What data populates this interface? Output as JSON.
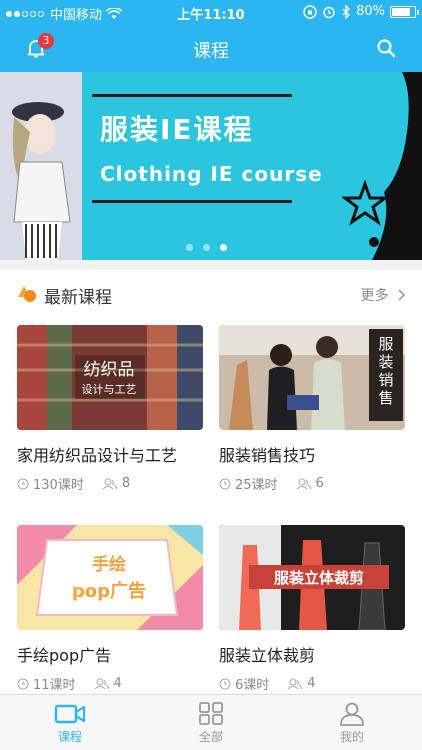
{
  "status_bar": {
    "carrier": "中国移动",
    "time": "上午11:10",
    "battery": "80%",
    "battery_level": 0.8
  },
  "header": {
    "title": "课程",
    "notification_count": "3"
  },
  "banner": {
    "title_cn": "服装IE课程",
    "title_en": "Clothing IE course",
    "active_page": 3,
    "pages": 3
  },
  "section": {
    "title": "最新课程",
    "more": "更多"
  },
  "courses": [
    {
      "title": "家用纺织品设计与工艺",
      "lessons": "130课时",
      "students": "8",
      "thumb_text": "纺织品\n设计与工艺",
      "thumb_color": "#8a3a3a"
    },
    {
      "title": "服装销售技巧",
      "lessons": "25课时",
      "students": "6",
      "thumb_text": "服装销售技巧",
      "thumb_color": "#c9b9a6"
    },
    {
      "title": "手绘pop广告",
      "lessons": "11课时",
      "students": "4",
      "thumb_text": "手绘pop广告",
      "thumb_color": "#f7e4a3"
    },
    {
      "title": "服装立体裁剪",
      "lessons": "6课时",
      "students": "4",
      "thumb_text": "服装立体裁剪",
      "thumb_color": "#2a2a2a"
    }
  ],
  "tabs": [
    {
      "label": "课程",
      "icon": "video-icon",
      "active": true
    },
    {
      "label": "全部",
      "icon": "grid-icon",
      "active": false
    },
    {
      "label": "我的",
      "icon": "user-icon",
      "active": false
    }
  ],
  "colors": {
    "primary": "#2cb6f0",
    "banner": "#2bc5df",
    "badge": "#e8363b"
  }
}
